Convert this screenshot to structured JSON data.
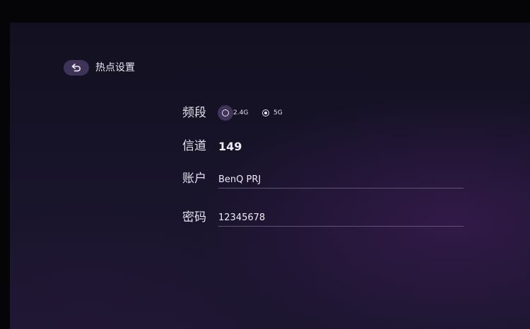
{
  "header": {
    "title": "热点设置",
    "back_icon": "back-arrow-icon"
  },
  "form": {
    "band": {
      "label": "频段",
      "options": [
        {
          "label": "2.4G",
          "selected": false,
          "focused": true
        },
        {
          "label": "5G",
          "selected": true,
          "focused": false
        }
      ]
    },
    "channel": {
      "label": "信道",
      "value": "149"
    },
    "account": {
      "label": "账户",
      "value": "BenQ PRJ"
    },
    "password": {
      "label": "密码",
      "value": "12345678"
    }
  },
  "colors": {
    "background": "#171329",
    "accent": "#3f3458",
    "text": "#e4e1ec",
    "underline": "#5c5470"
  }
}
